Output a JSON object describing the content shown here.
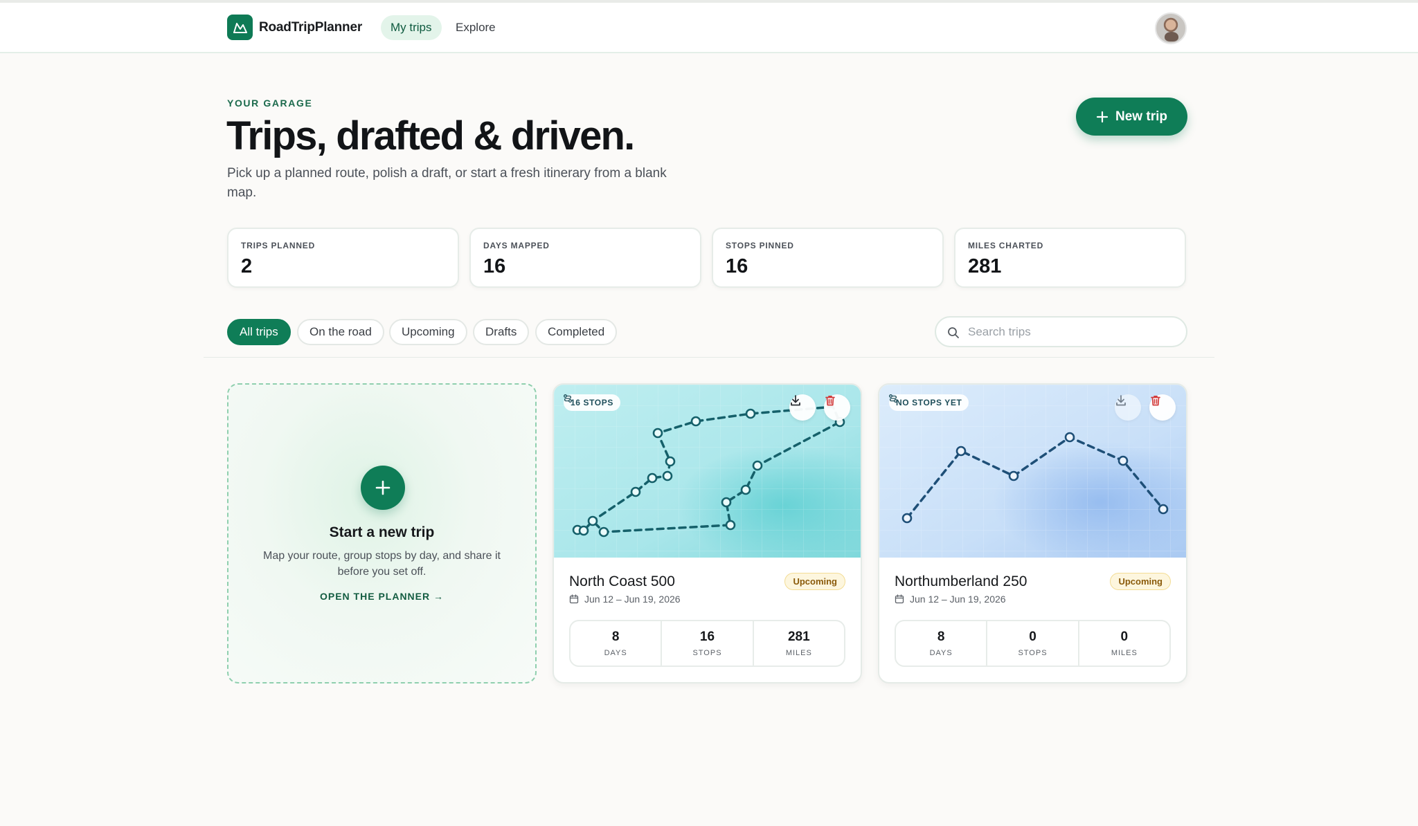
{
  "app": {
    "brand": "RoadTripPlanner",
    "nav": [
      {
        "label": "My trips",
        "active": true
      },
      {
        "label": "Explore",
        "active": false
      }
    ],
    "colors": {
      "accent": "#0f7d57",
      "status_upcoming_bg": "#fdf6de",
      "status_upcoming_text": "#8a5a0a",
      "danger": "#d23b3b"
    }
  },
  "hero": {
    "eyebrow": "YOUR GARAGE",
    "title": "Trips, drafted & driven.",
    "subtitle": "Pick up a planned route, polish a draft, or start a fresh itinerary from a blank map.",
    "new_trip_label": "New trip"
  },
  "stats": [
    {
      "label": "TRIPS PLANNED",
      "value": "2"
    },
    {
      "label": "DAYS MAPPED",
      "value": "16"
    },
    {
      "label": "STOPS PINNED",
      "value": "16"
    },
    {
      "label": "MILES CHARTED",
      "value": "281"
    }
  ],
  "filters": [
    {
      "label": "All trips",
      "active": true
    },
    {
      "label": "On the road",
      "active": false
    },
    {
      "label": "Upcoming",
      "active": false
    },
    {
      "label": "Drafts",
      "active": false
    },
    {
      "label": "Completed",
      "active": false
    }
  ],
  "search": {
    "placeholder": "Search trips",
    "value": ""
  },
  "new_card": {
    "title": "Start a new trip",
    "description": "Map your route, group stops by day, and share it before you set off.",
    "cta": "OPEN THE PLANNER →"
  },
  "trips": [
    {
      "name": "North Coast 500",
      "status": "Upcoming",
      "dates": "Jun 12 – Jun 19, 2026",
      "badge": "16 STOPS",
      "stats": [
        {
          "value": "8",
          "label": "DAYS"
        },
        {
          "value": "16",
          "label": "STOPS"
        },
        {
          "value": "281",
          "label": "MILES"
        }
      ]
    },
    {
      "name": "Northumberland 250",
      "status": "Upcoming",
      "dates": "Jun 12 – Jun 19, 2026",
      "badge": "NO STOPS YET",
      "stats": [
        {
          "value": "8",
          "label": "DAYS"
        },
        {
          "value": "0",
          "label": "STOPS"
        },
        {
          "value": "0",
          "label": "MILES"
        }
      ]
    }
  ]
}
